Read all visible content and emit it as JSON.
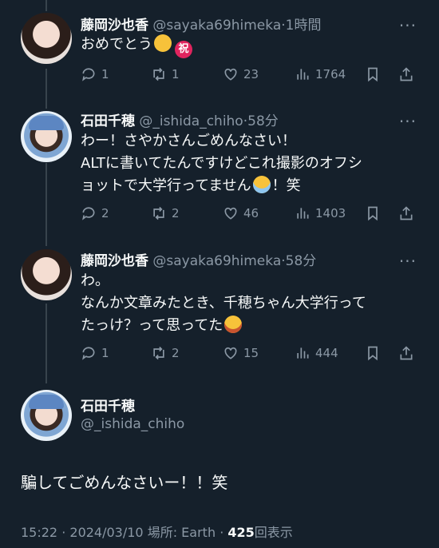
{
  "tweets": [
    {
      "name": "藤岡沙也香",
      "handle": "@sayaka69himeka",
      "time": "1時間",
      "text_lines": [
        "おめでとう"
      ],
      "emoji_after": [
        "smiling-face",
        "iwai"
      ],
      "iwai_char": "祝",
      "replies": "1",
      "retweets": "1",
      "likes": "23",
      "views": "1764"
    },
    {
      "name": "石田千穂",
      "handle": "@_ishida_chiho",
      "time": "58分",
      "text_lines": [
        "わー！さやかさんごめんなさい！",
        "ALTに書いてたんですけどこれ撮影のオフシ",
        "ョットで大学行ってません",
        "！笑"
      ],
      "replies": "2",
      "retweets": "2",
      "likes": "46",
      "views": "1403"
    },
    {
      "name": "藤岡沙也香",
      "handle": "@sayaka69himeka",
      "time": "58分",
      "text_lines": [
        "わ。",
        "なんか文章みたとき、千穂ちゃん大学行って",
        "たっけ？って思ってた"
      ],
      "replies": "1",
      "retweets": "2",
      "likes": "15",
      "views": "444"
    }
  ],
  "main": {
    "name": "石田千穂",
    "handle": "@_ishida_chiho",
    "text": "騙してごめんなさいー！！笑",
    "time": "15:22",
    "date": "2024/03/10",
    "location": "場所: Earth",
    "view_count": "425",
    "view_label": "回表示"
  },
  "separator": "·",
  "more": "···",
  "icons": [
    "reply-icon",
    "retweet-icon",
    "like-icon",
    "views-icon",
    "bookmark-icon",
    "share-icon"
  ],
  "colors": {
    "background": "#15202b",
    "secondary_text": "#8b98a5",
    "thread_line": "#38444d"
  }
}
